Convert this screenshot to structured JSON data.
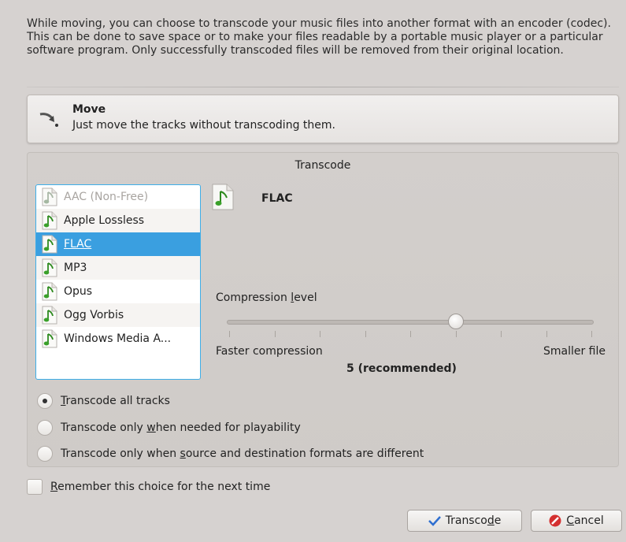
{
  "intro_text": "While moving, you can choose to transcode your music files into another format with an encoder (codec). This can be done to save space or to make your files readable by a portable music player or a particular software program. Only successfully transcoded files will be removed from their original location.",
  "move_option": {
    "title": "Move",
    "description": "Just move the tracks without transcoding them.",
    "icon": "move-arrow-icon"
  },
  "transcode_group": {
    "title": "Transcode",
    "codecs": [
      {
        "label": "AAC (Non-Free)",
        "state": "disabled"
      },
      {
        "label": "Apple Lossless",
        "state": "normal"
      },
      {
        "label": "FLAC",
        "state": "selected"
      },
      {
        "label": "MP3",
        "state": "normal"
      },
      {
        "label": "Opus",
        "state": "normal"
      },
      {
        "label": "Ogg Vorbis",
        "state": "normal"
      },
      {
        "label": "Windows Media A...",
        "state": "normal"
      }
    ],
    "selected_codec": "FLAC",
    "compression_label_pre": "Compression ",
    "compression_label_key": "l",
    "compression_label_post": "evel",
    "slider_value": 5,
    "slider_min": 0,
    "slider_max": 8,
    "faster_label": "Faster compression",
    "smaller_label": "Smaller file",
    "level_value_text": "5 (recommended)"
  },
  "radio_options": [
    {
      "pre": "",
      "key": "T",
      "post": "ranscode all tracks",
      "checked": true
    },
    {
      "pre": "Transcode only ",
      "key": "w",
      "post": "hen needed for playability",
      "checked": false
    },
    {
      "pre": "Transcode only when ",
      "key": "s",
      "post": "ource and destination formats are different",
      "checked": false
    }
  ],
  "remember": {
    "pre": "",
    "key": "R",
    "post": "emember this choice for the next time",
    "checked": false
  },
  "buttons": {
    "transcode": {
      "pre": "Transco",
      "key": "d",
      "post": "e"
    },
    "cancel": {
      "pre": "",
      "key": "C",
      "post": "ancel"
    }
  },
  "colors": {
    "selection": "#3a9fe0",
    "note_green": "#3aa02a",
    "cancel_red": "#d42f2f",
    "check_blue": "#2f6fd0"
  }
}
